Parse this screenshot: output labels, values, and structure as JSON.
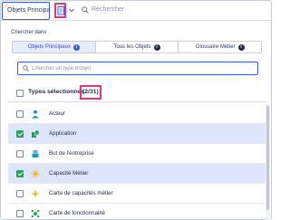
{
  "topbar": {
    "scope_label": "Objets Principaux",
    "search_placeholder": "Rechercher"
  },
  "panel": {
    "search_in_label": "Chercher dans",
    "tabs": [
      {
        "label": "Objets Principaux",
        "active": true
      },
      {
        "label": "Tous les Objets",
        "active": false
      },
      {
        "label": "Glossaire Métier",
        "active": false
      }
    ],
    "info_glyph": "i",
    "type_search_placeholder": "Chercher un type d'objet"
  },
  "list": {
    "header_label": "Types sélectionnés",
    "selected_count": "(2/31)",
    "items": [
      {
        "label": "Acteur",
        "checked": false,
        "icon": "actor-icon"
      },
      {
        "label": "Application",
        "checked": true,
        "icon": "application-icon"
      },
      {
        "label": "But de l'entreprise",
        "checked": false,
        "icon": "enterprise-goal-icon"
      },
      {
        "label": "Capacité Métier",
        "checked": true,
        "icon": "business-capability-icon"
      },
      {
        "label": "Carte de capacités métier",
        "checked": false,
        "icon": "capability-map-icon"
      },
      {
        "label": "Carte de fonctionnalité",
        "checked": false,
        "icon": "feature-map-icon"
      }
    ]
  },
  "colors": {
    "accent": "#3b5bdb",
    "highlight": "#e0357a",
    "check": "#22a35a",
    "selected_row": "#dfe5fb"
  }
}
